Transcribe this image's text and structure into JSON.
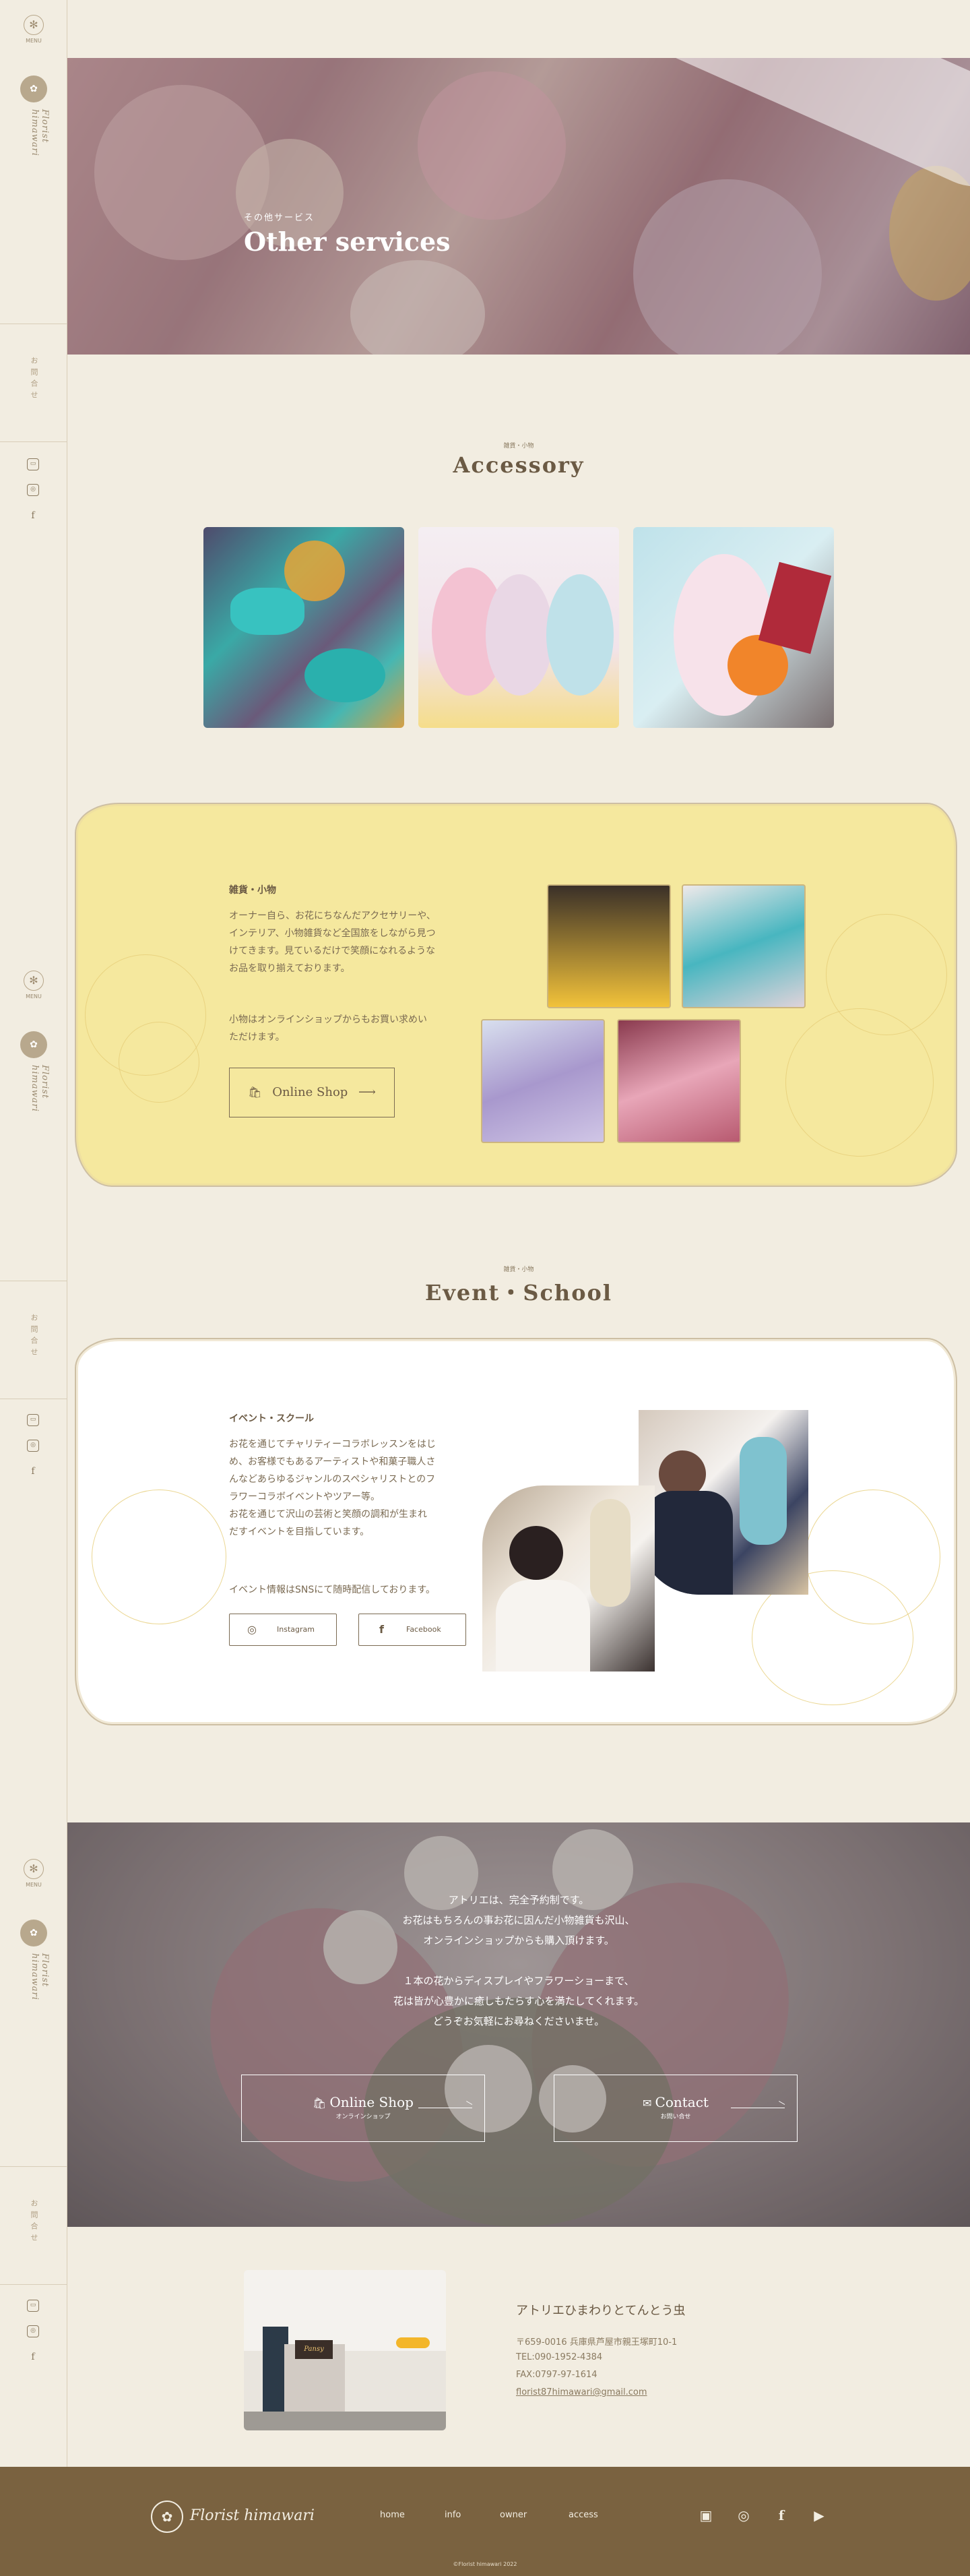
{
  "sidebar": {
    "menu_label": "MENU",
    "brand": "Florist himawari",
    "contact_label": "お問合せ"
  },
  "hero": {
    "subtitle": "その他サービス",
    "title": "Other services"
  },
  "accessory": {
    "heading_small": "雑貨・小物",
    "heading": "Accessory",
    "panel_title": "雑貨・小物",
    "panel_text": "オーナー自ら、お花にちなんだアクセサリーや、\nインテリア、小物雑貨など全国旅をしながら見つ\nけてきます。見ているだけで笑顔になれるような\nお品を取り揃えております。",
    "panel_text2": "小物はオンラインショップからもお買い求めい\nただけます。",
    "shop_button": "Online Shop"
  },
  "event": {
    "heading_small": "雑貨・小物",
    "heading": "Event・School",
    "panel_title": "イベント・スクール",
    "panel_text": "お花を通じてチャリティーコラボレッスンをはじ\nめ、お客様でもあるアーティストや和菓子職人さ\nんなどあらゆるジャンルのスペシャリストとのフ\nラワーコラボイベントやツアー等。\nお花を通じて沢山の芸術と笑顔の調和が生まれ\nだすイベントを目指しています。",
    "panel_text2": "イベント情報はSNSにて随時配信しております。",
    "instagram_button": "Instagram",
    "facebook_button": "Facebook"
  },
  "banner": {
    "copy": "アトリエは、完全予約制です。\nお花はもちろんの事お花に因んだ小物雑貨も沢山、\nオンラインショップからも購入頂けます。\n\n１本の花からディスプレイやフラワーショーまで、\n花は皆が心豊かに癒しもたらす心を満たしてくれます。\nどうぞお気軽にお尋ねくださいませ。",
    "shop_button": "Online Shop",
    "shop_button_sub": "オンラインショップ",
    "contact_button": "Contact",
    "contact_button_sub": "お問い合せ"
  },
  "access": {
    "name": "アトリエひまわりとてんとう虫",
    "address": "〒659-0016 兵庫県芦屋市親王塚町10-1",
    "tel": "TEL:090-1952-4384",
    "fax": "FAX:0797-97-1614",
    "email": "florist87himawari@gmail.com",
    "sign_text": "Pansy"
  },
  "footer": {
    "brand": "Florist himawari",
    "nav": [
      "home",
      "info",
      "owner",
      "access"
    ],
    "copyright": "©Florist himawari 2022"
  },
  "colors": {
    "background": "#f2ede1",
    "text": "#6b5a44",
    "yellow_panel": "#f5e89e",
    "footer": "#7a6240"
  }
}
